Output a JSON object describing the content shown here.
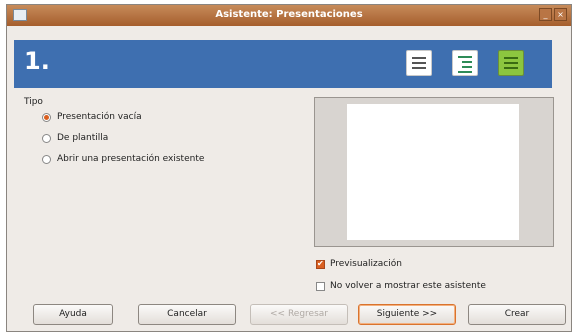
{
  "window": {
    "title": "Asistente: Presentaciones"
  },
  "banner": {
    "step": "1."
  },
  "tipo": {
    "label": "Tipo",
    "options": [
      {
        "label": "Presentación vacía",
        "selected": true
      },
      {
        "label": "De plantilla",
        "selected": false
      },
      {
        "label": "Abrir una presentación existente",
        "selected": false
      }
    ]
  },
  "options": {
    "preview_label": "Previsualización",
    "preview_checked": true,
    "no_show_label": "No volver a mostrar este asistente",
    "no_show_checked": false
  },
  "buttons": {
    "help": "Ayuda",
    "cancel": "Cancelar",
    "back": "<< Regresar",
    "next": "Siguiente >>",
    "create": "Crear"
  },
  "colors": {
    "titlebar": "#b0693a",
    "banner": "#3e6fb0",
    "accent": "#d95f20"
  }
}
